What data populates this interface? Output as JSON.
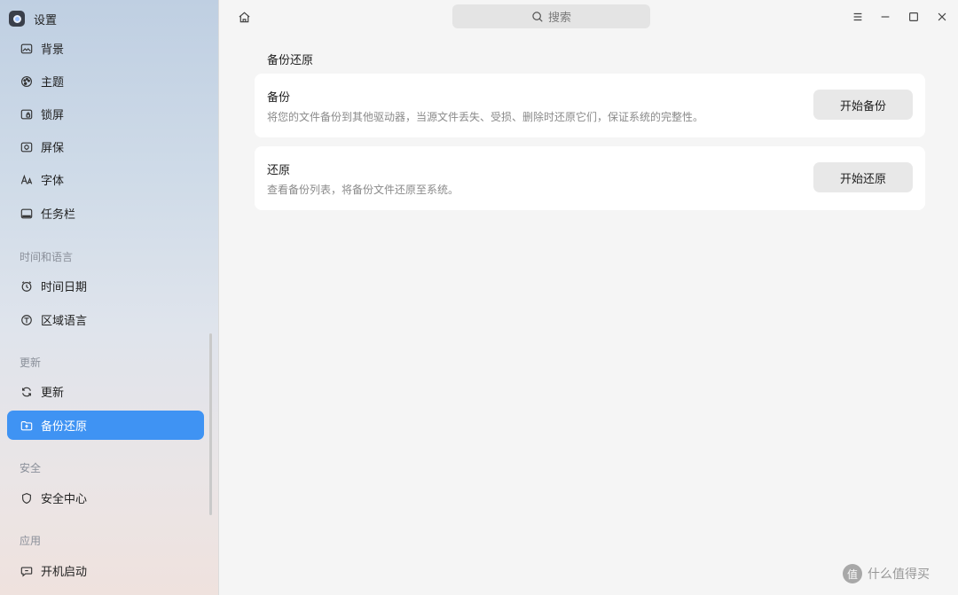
{
  "app": {
    "title": "设置"
  },
  "sidebar": {
    "items": [
      {
        "label": "背景",
        "icon": "background-icon"
      },
      {
        "label": "主题",
        "icon": "palette-icon"
      },
      {
        "label": "锁屏",
        "icon": "lock-screen-icon"
      },
      {
        "label": "屏保",
        "icon": "screensaver-icon"
      },
      {
        "label": "字体",
        "icon": "font-icon"
      },
      {
        "label": "任务栏",
        "icon": "taskbar-icon"
      },
      {
        "label": "时间日期",
        "icon": "clock-icon"
      },
      {
        "label": "区域语言",
        "icon": "language-icon"
      },
      {
        "label": "更新",
        "icon": "refresh-icon"
      },
      {
        "label": "备份还原",
        "icon": "backup-icon",
        "active": true
      },
      {
        "label": "安全中心",
        "icon": "shield-icon"
      },
      {
        "label": "开机启动",
        "icon": "startup-icon"
      }
    ],
    "sections": [
      "时间和语言",
      "更新",
      "安全",
      "应用"
    ]
  },
  "search": {
    "placeholder": "搜索"
  },
  "main": {
    "title": "备份还原",
    "cards": [
      {
        "title": "备份",
        "desc": "将您的文件备份到其他驱动器，当源文件丢失、受损、删除时还原它们，保证系统的完整性。",
        "button": "开始备份"
      },
      {
        "title": "还原",
        "desc": "查看备份列表，将备份文件还原至系统。",
        "button": "开始还原"
      }
    ]
  },
  "watermark": {
    "logo": "值",
    "text": "什么值得买"
  },
  "colors": {
    "accent": "#3f93f3"
  }
}
